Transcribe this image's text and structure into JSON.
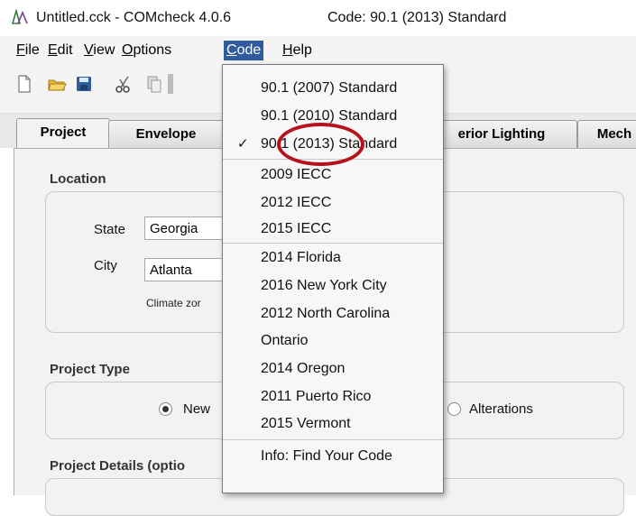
{
  "window": {
    "title": "Untitled.cck - COMcheck 4.0.6",
    "code_status": "Code: 90.1 (2013) Standard"
  },
  "menubar": {
    "items": [
      "File",
      "Edit",
      "View",
      "Options",
      "Code",
      "Help"
    ],
    "active": "Code"
  },
  "toolbar": {
    "icons": [
      "new-file-icon",
      "open-folder-icon",
      "save-icon",
      "cut-icon",
      "copy-icon"
    ]
  },
  "tabs": {
    "items": [
      "Project",
      "Envelope",
      "erior Lighting",
      "Mech"
    ],
    "selected": "Project"
  },
  "project": {
    "location_label": "Location",
    "state_label": "State",
    "state_value": "Georgia",
    "city_label": "City",
    "city_value": "Atlanta",
    "climate_zone_label": "Climate zor",
    "project_type_label": "Project Type",
    "type_new_label": "New",
    "type_alterations_label": "Alterations",
    "project_details_label": "Project Details (optio"
  },
  "code_menu": {
    "items": [
      {
        "label": "90.1 (2007) Standard",
        "checked": false
      },
      {
        "label": "90.1 (2010) Standard",
        "checked": false
      },
      {
        "label": "90.1 (2013) Standard",
        "checked": true
      },
      {
        "label": "2009 IECC",
        "checked": false
      },
      {
        "label": "2012 IECC",
        "checked": false
      },
      {
        "label": "2015 IECC",
        "checked": false
      },
      {
        "label": "2014 Florida",
        "checked": false
      },
      {
        "label": "2016 New York City",
        "checked": false
      },
      {
        "label": "2012 North Carolina",
        "checked": false
      },
      {
        "label": "Ontario",
        "checked": false
      },
      {
        "label": "2014 Oregon",
        "checked": false
      },
      {
        "label": "2011 Puerto Rico",
        "checked": false
      },
      {
        "label": "2015 Vermont",
        "checked": false
      },
      {
        "label": "Info: Find Your Code",
        "checked": false
      }
    ],
    "check_glyph": "✓"
  },
  "colors": {
    "menu_highlight": "#2f5a9c",
    "annotation_circle": "#b5121b"
  }
}
